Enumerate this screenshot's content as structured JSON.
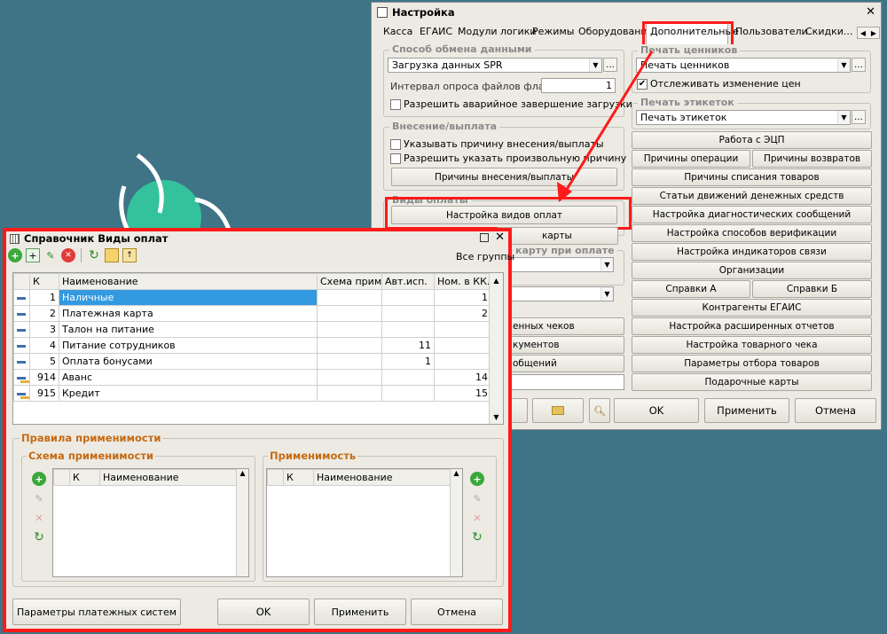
{
  "settings": {
    "title": "Настройка",
    "close_glyph": "✕",
    "tabs": [
      "Касса",
      "ЕГАИС",
      "Модули логики",
      "Режимы",
      "Оборудование",
      "Дополнительные",
      "Пользователи",
      "Скидки..."
    ],
    "exchange_group": "Способ обмена данными",
    "exchange_value": "Загрузка данных SPR",
    "poll_label": "Интервал опроса файлов флагов:",
    "poll_value": "1",
    "allow_abort": "Разрешить аварийное завершение загрузки",
    "cash_group": "Внесение/выплата",
    "cash_reason": "Указывать причину внесения/выплаты",
    "cash_arbitrary": "Разрешить указать произвольную причину",
    "cash_reasons_btn": "Причины внесения/выплаты",
    "pay_group": "Виды оплаты",
    "pay_setup_btn": "Настройка видов оплат",
    "partial_cards": "карты",
    "partial_card_on_pay": "карту при оплате",
    "partial_checks": "енных чеков",
    "partial_docs": "кументов",
    "partial_msgs": "общений",
    "price_tags_group": "Печать ценников",
    "price_tags_value": "Печать ценников",
    "track_price": "Отслеживать изменение цен",
    "labels_group": "Печать этикеток",
    "labels_value": "Печать этикеток",
    "right_buttons": {
      "ecp": "Работа с ЭЦП",
      "op_reasons": "Причины операции",
      "return_reasons": "Причины возвратов",
      "writeoff": "Причины списания товаров",
      "cash_flow": "Статьи движений денежных средств",
      "diag": "Настройка диагностических сообщений",
      "verify": "Настройка способов верификации",
      "indicators": "Настройка индикаторов связи",
      "orgs": "Организации",
      "ref_a": "Справки А",
      "ref_b": "Справки Б",
      "egais_contr": "Контрагенты ЕГАИС",
      "ext_reports": "Настройка расширенных отчетов",
      "receipt": "Настройка товарного чека",
      "filter": "Параметры отбора товаров",
      "gift": "Подарочные карты"
    },
    "ok": "OK",
    "apply": "Применить",
    "cancel": "Отмена"
  },
  "dialog": {
    "title": "Справочник Виды оплат",
    "all_groups": "Все группы",
    "columns": [
      "К",
      "Наименование",
      "Схема прим.",
      "Авт.исп.",
      "Ном. в КК..."
    ],
    "rows": [
      {
        "code": "1",
        "name": "Наличные",
        "scheme": "",
        "auto": "",
        "num": "1"
      },
      {
        "code": "2",
        "name": "Платежная карта",
        "scheme": "",
        "auto": "",
        "num": "2"
      },
      {
        "code": "3",
        "name": "Талон на питание",
        "scheme": "",
        "auto": "",
        "num": ""
      },
      {
        "code": "4",
        "name": "Питание сотрудников",
        "scheme": "",
        "auto": "11",
        "num": ""
      },
      {
        "code": "5",
        "name": "Оплата бонусами",
        "scheme": "",
        "auto": "1",
        "num": ""
      },
      {
        "code": "914",
        "name": "Аванс",
        "scheme": "",
        "auto": "",
        "num": "14"
      },
      {
        "code": "915",
        "name": "Кредит",
        "scheme": "",
        "auto": "",
        "num": "15"
      }
    ],
    "rules_title": "Правила применимости",
    "scheme_title": "Схема применимости",
    "applic_title": "Применимость",
    "sub_columns": [
      "К",
      "Наименование"
    ],
    "pay_systems_btn": "Параметры платежных систем",
    "ok": "OK",
    "apply": "Применить",
    "cancel": "Отмена"
  }
}
